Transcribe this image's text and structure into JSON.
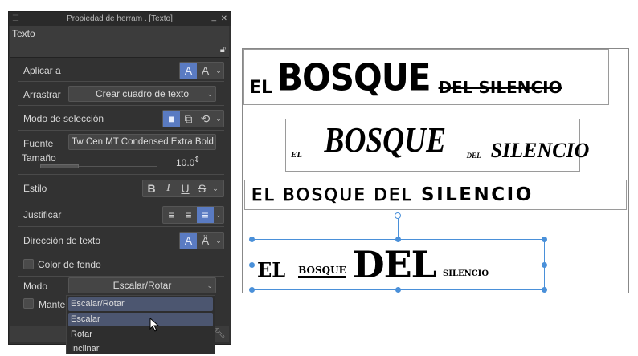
{
  "panel": {
    "title": "Propiedad de herram . [Texto]",
    "section": "Texto",
    "rows": {
      "apply_to": "Aplicar a",
      "drag": "Arrastrar",
      "drag_value": "Crear cuadro de texto",
      "selection_mode": "Modo de selección",
      "font": "Fuente",
      "font_value": "Tw Cen MT Condensed Extra Bold",
      "size": "Tamaño",
      "size_value": "10.0",
      "style": "Estilo",
      "justify": "Justificar",
      "text_direction": "Dirección de texto",
      "bg_color": "Color de fondo",
      "mode": "Modo",
      "mode_value": "Escalar/Rotar",
      "keep": "Manter"
    },
    "style_buttons": [
      "B",
      "I",
      "U",
      "S"
    ],
    "justify_active": "right",
    "accent": "#5a7bc2"
  },
  "dropdown": {
    "options": [
      "Escalar/Rotar",
      "Escalar",
      "Rotar",
      "Inclinar"
    ],
    "selected": "Escalar/Rotar",
    "hovered": "Escalar"
  },
  "canvas": {
    "lines": [
      [
        "EL",
        "BOSQUE",
        "DEL SILENCIO"
      ],
      [
        "EL",
        "BOSQUE",
        "DEL",
        "SILENCIO"
      ],
      [
        "EL BOSQUE DEL",
        "SILENCIO"
      ],
      [
        "EL",
        "BOSQUE",
        "DEL",
        "SILENCIO"
      ]
    ]
  }
}
